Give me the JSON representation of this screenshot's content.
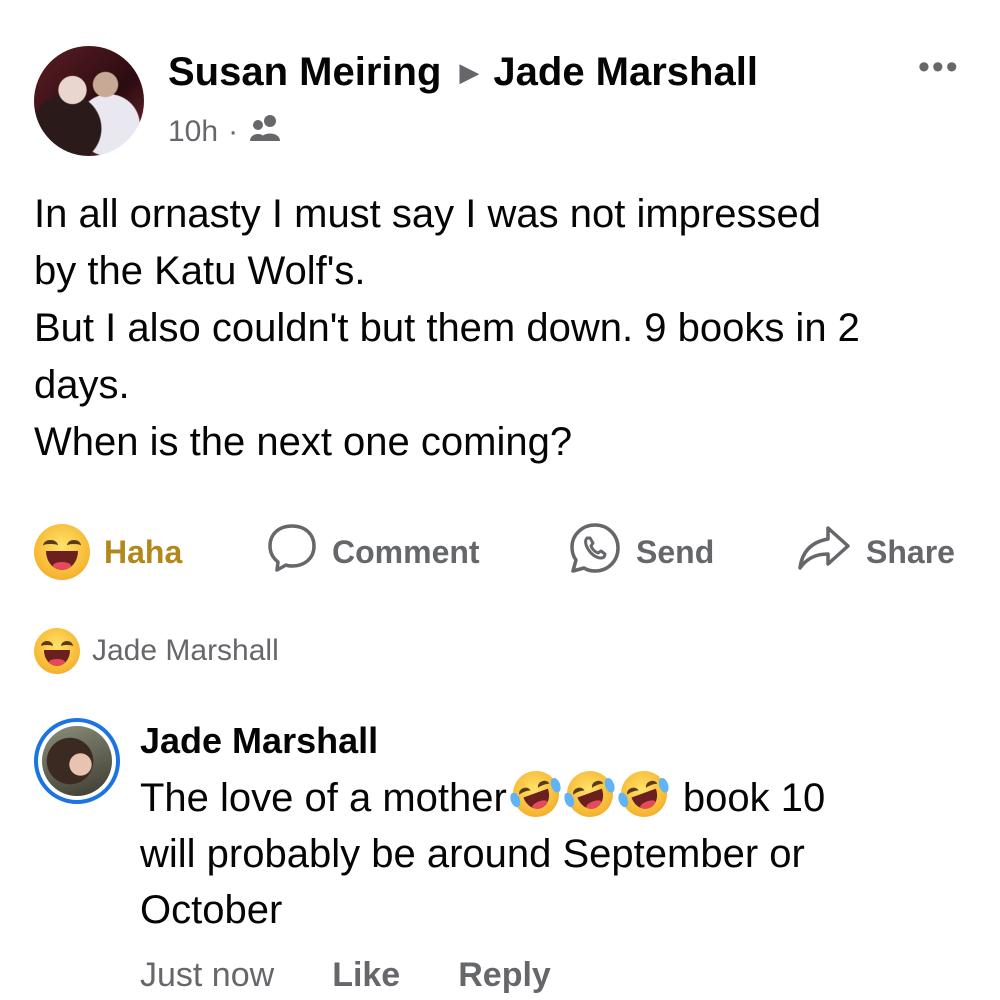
{
  "post": {
    "author": "Susan Meiring",
    "target": "Jade Marshall",
    "time": "10h",
    "separator": "·",
    "audience_icon": "friends-icon",
    "more_icon": "more-options-icon",
    "more_label": "•••",
    "lines": [
      "In all ornasty I must say I was not impressed",
      "by the Katu Wolf's.",
      "But I also couldn't but them down. 9 books in 2",
      "days.",
      "When is the next one coming?"
    ]
  },
  "actions": {
    "reaction_label": "Haha",
    "comment_label": "Comment",
    "send_label": "Send",
    "share_label": "Share"
  },
  "reacted_by": {
    "name": "Jade Marshall"
  },
  "comment": {
    "author": "Jade Marshall",
    "text_before": "The love of a mother",
    "text_after": "book 10",
    "line2": "will probably be around September or",
    "line3": "October",
    "emoji_count": 3,
    "time": "Just now",
    "like_label": "Like",
    "reply_label": "Reply"
  },
  "colors": {
    "accent": "#1b74e4",
    "haha": "#b3871a",
    "secondary_text": "#65676b"
  }
}
